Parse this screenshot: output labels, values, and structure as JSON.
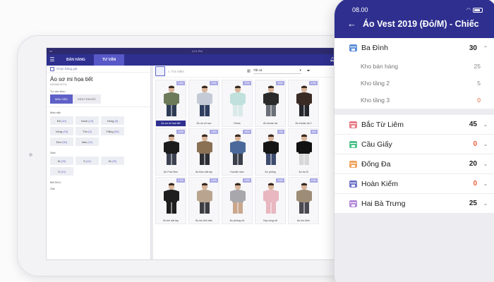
{
  "tablet": {
    "status_time": "4:21 PM",
    "nav": {
      "tab_sales": "BÁN HÀNG",
      "tab_consult": "TƯ VẤN"
    },
    "left": {
      "price_book": "Chọn bảng giá",
      "product_name": "Áo sơ mi họa tiết",
      "product_code": "ASSMN NT01",
      "consult_by": "Tư vấn theo",
      "toggle_color": "MÀU SẮC",
      "toggle_size": "KÍCH THƯỚC",
      "color_label": "Màu sắc",
      "colors": [
        {
          "name": "Đỏ",
          "count": "(10)"
        },
        {
          "name": "Xanh",
          "count": "(13)"
        },
        {
          "name": "Hồng",
          "count": "(5)"
        },
        {
          "name": "Vàng",
          "count": "(15)"
        },
        {
          "name": "Tím",
          "count": "(3)"
        },
        {
          "name": "Trắng",
          "count": "(32)"
        },
        {
          "name": "Đen",
          "count": "(50)"
        },
        {
          "name": "Nâu",
          "count": "(12)"
        }
      ],
      "size_label": "Size",
      "sizes": [
        {
          "name": "M",
          "count": "(29)"
        },
        {
          "name": "S",
          "count": "(10)"
        },
        {
          "name": "M",
          "count": "(29)"
        },
        {
          "name": "S",
          "count": "(10)"
        }
      ],
      "sku_label": "Mã SKU:",
      "price_label": "Giá:"
    },
    "right": {
      "search_placeholder": "Tìm kiếm",
      "filter_all": "Tất cả",
      "products": [
        {
          "name": "Áo sơ mi họa tiết",
          "qty": "243k",
          "shirt": "#6c7a5a",
          "pants": "#2e3b55",
          "selected": true
        },
        {
          "name": "Áo sơ mi sọc",
          "qty": "235k",
          "shirt": "#c4cbd6",
          "pants": "#2f3e5e",
          "selected": false
        },
        {
          "name": "Dress",
          "qty": "325k",
          "shirt": "#bfe0dc",
          "pants": "#d9eae8",
          "selected": false
        },
        {
          "name": "Áo khoác da",
          "qty": "450k",
          "shirt": "#2a2a2a",
          "pants": "#6b6f78",
          "selected": false
        },
        {
          "name": "Áo khoác da 2",
          "qty": "415k",
          "shirt": "#3a2b24",
          "pants": "#24262c",
          "selected": false
        },
        {
          "name": "Áo Polo Đen",
          "qty": "143k",
          "shirt": "#1c1c1c",
          "pants": "#3b4150",
          "selected": false
        },
        {
          "name": "Áo thun dài tay",
          "qty": "130k",
          "shirt": "#8a7154",
          "pants": "#2d2d35",
          "selected": false
        },
        {
          "name": "Hoodie nam",
          "qty": "460k",
          "shirt": "#4b6a9b",
          "pants": "#3a3f4a",
          "selected": false
        },
        {
          "name": "Áo phông",
          "qty": "90k",
          "shirt": "#151515",
          "pants": "#3d4b6e",
          "selected": false
        },
        {
          "name": "Áo ba lỗ",
          "qty": "80k",
          "shirt": "#111111",
          "pants": "#d7d7d7",
          "selected": false
        },
        {
          "name": "Áo len dài tay",
          "qty": "170k",
          "shirt": "#1e1e1e",
          "pants": "#1e1e1e",
          "selected": false
        },
        {
          "name": "Áo len thổ cẩm",
          "qty": "225k",
          "shirt": "#b9a58f",
          "pants": "#3d3d44",
          "selected": false
        },
        {
          "name": "Áo phông nữ",
          "qty": "150k",
          "shirt": "#a8a8ac",
          "pants": "#c9a68c",
          "selected": false
        },
        {
          "name": "Váy công sở",
          "qty": "125k",
          "shirt": "#e8b7c0",
          "pants": "#e8b7c0",
          "selected": false
        },
        {
          "name": "Áo len thêu",
          "qty": "115k",
          "shirt": "#9d8d77",
          "pants": "#4a4a52",
          "selected": false
        }
      ]
    }
  },
  "phone": {
    "status_time": "08.00",
    "title": "Áo Vest 2019 (Đỏ/M) - Chiếc",
    "warehouses": [
      {
        "name": "Ba Đình",
        "value": "30",
        "icon_color": "#5b8fd9",
        "value_color": "#222222",
        "expanded": true,
        "subs": [
          {
            "name": "Kho bán hàng",
            "value": "25",
            "value_color": "#888888"
          },
          {
            "name": "Kho tầng 2",
            "value": "5",
            "value_color": "#888888"
          },
          {
            "name": "Kho tầng 3",
            "value": "0",
            "value_color": "#e8603c"
          }
        ]
      },
      {
        "name": "Bắc Từ Liêm",
        "value": "45",
        "icon_color": "#e77b86",
        "value_color": "#222222",
        "expanded": false
      },
      {
        "name": "Cầu Giấy",
        "value": "0",
        "icon_color": "#4cc28a",
        "value_color": "#e8603c",
        "expanded": false
      },
      {
        "name": "Đống Đa",
        "value": "20",
        "icon_color": "#f2a25c",
        "value_color": "#222222",
        "expanded": false
      },
      {
        "name": "Hoàn Kiếm",
        "value": "0",
        "icon_color": "#6f74c9",
        "value_color": "#e8603c",
        "expanded": false
      },
      {
        "name": "Hai Bà Trưng",
        "value": "25",
        "icon_color": "#b58ad9",
        "value_color": "#222222",
        "expanded": false
      }
    ]
  }
}
